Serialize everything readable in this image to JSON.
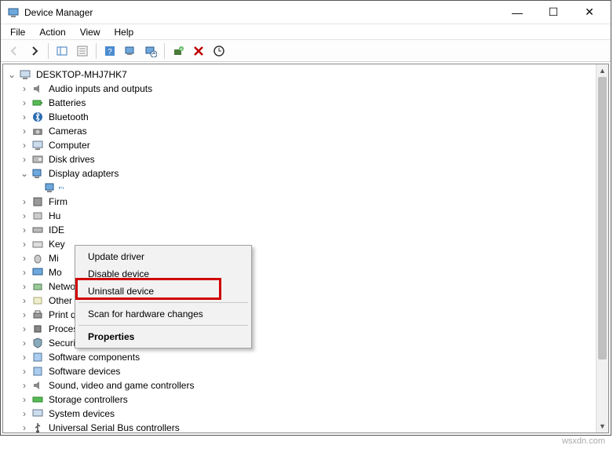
{
  "window": {
    "title": "Device Manager",
    "controls": {
      "min": "—",
      "max": "☐",
      "close": "✕"
    }
  },
  "menu": {
    "file": "File",
    "action": "Action",
    "view": "View",
    "help": "Help"
  },
  "toolbar": {
    "back": "←",
    "forward": "→",
    "list": "list-icon",
    "props": "properties-icon",
    "help": "help-icon",
    "monitor_play": "monitor-play-icon",
    "monitor_search": "monitor-search-icon",
    "add_hw": "add-hardware-icon",
    "delete": "✖",
    "scan": "scan-icon"
  },
  "tree": {
    "root": "DESKTOP-MHJ7HK7",
    "items": [
      {
        "label": "Audio inputs and outputs"
      },
      {
        "label": "Batteries"
      },
      {
        "label": "Bluetooth"
      },
      {
        "label": "Cameras"
      },
      {
        "label": "Computer"
      },
      {
        "label": "Disk drives"
      },
      {
        "label": "Display adapters",
        "expanded": true,
        "child": ""
      },
      {
        "label": "Firm"
      },
      {
        "label": "Hu"
      },
      {
        "label": "IDE"
      },
      {
        "label": "Key"
      },
      {
        "label": "Mi"
      },
      {
        "label": "Mo"
      },
      {
        "label": "Network adapters"
      },
      {
        "label": "Other devices"
      },
      {
        "label": "Print queues"
      },
      {
        "label": "Processors"
      },
      {
        "label": "Security devices"
      },
      {
        "label": "Software components"
      },
      {
        "label": "Software devices"
      },
      {
        "label": "Sound, video and game controllers"
      },
      {
        "label": "Storage controllers"
      },
      {
        "label": "System devices"
      },
      {
        "label": "Universal Serial Bus controllers"
      }
    ]
  },
  "context_menu": {
    "update": "Update driver",
    "disable": "Disable device",
    "uninstall": "Uninstall device",
    "scan": "Scan for hardware changes",
    "properties": "Properties"
  },
  "watermark": "wsxdn.com"
}
